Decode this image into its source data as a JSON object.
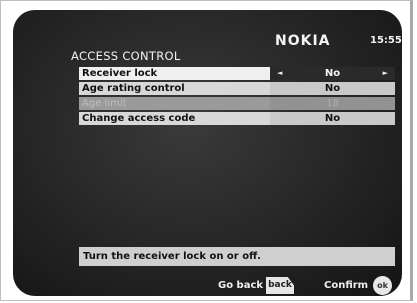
{
  "header": {
    "title": "ACCESS CONTROL",
    "brand": "NOKIA",
    "clock": "15:55"
  },
  "menu": {
    "items": [
      {
        "label": "Receiver lock",
        "value": "No",
        "state": "selected"
      },
      {
        "label": "Age rating control",
        "value": "No",
        "state": "normal"
      },
      {
        "label": "Age limit",
        "value": "18",
        "state": "disabled"
      },
      {
        "label": "Change access code",
        "value": "No",
        "state": "normal"
      }
    ],
    "arrow_left": "◄",
    "arrow_right": "►"
  },
  "help_text": "Turn the receiver lock on or off.",
  "footer": {
    "go_back_label": "Go back",
    "back_key": "back",
    "confirm_label": "Confirm",
    "ok_key": "ok"
  }
}
